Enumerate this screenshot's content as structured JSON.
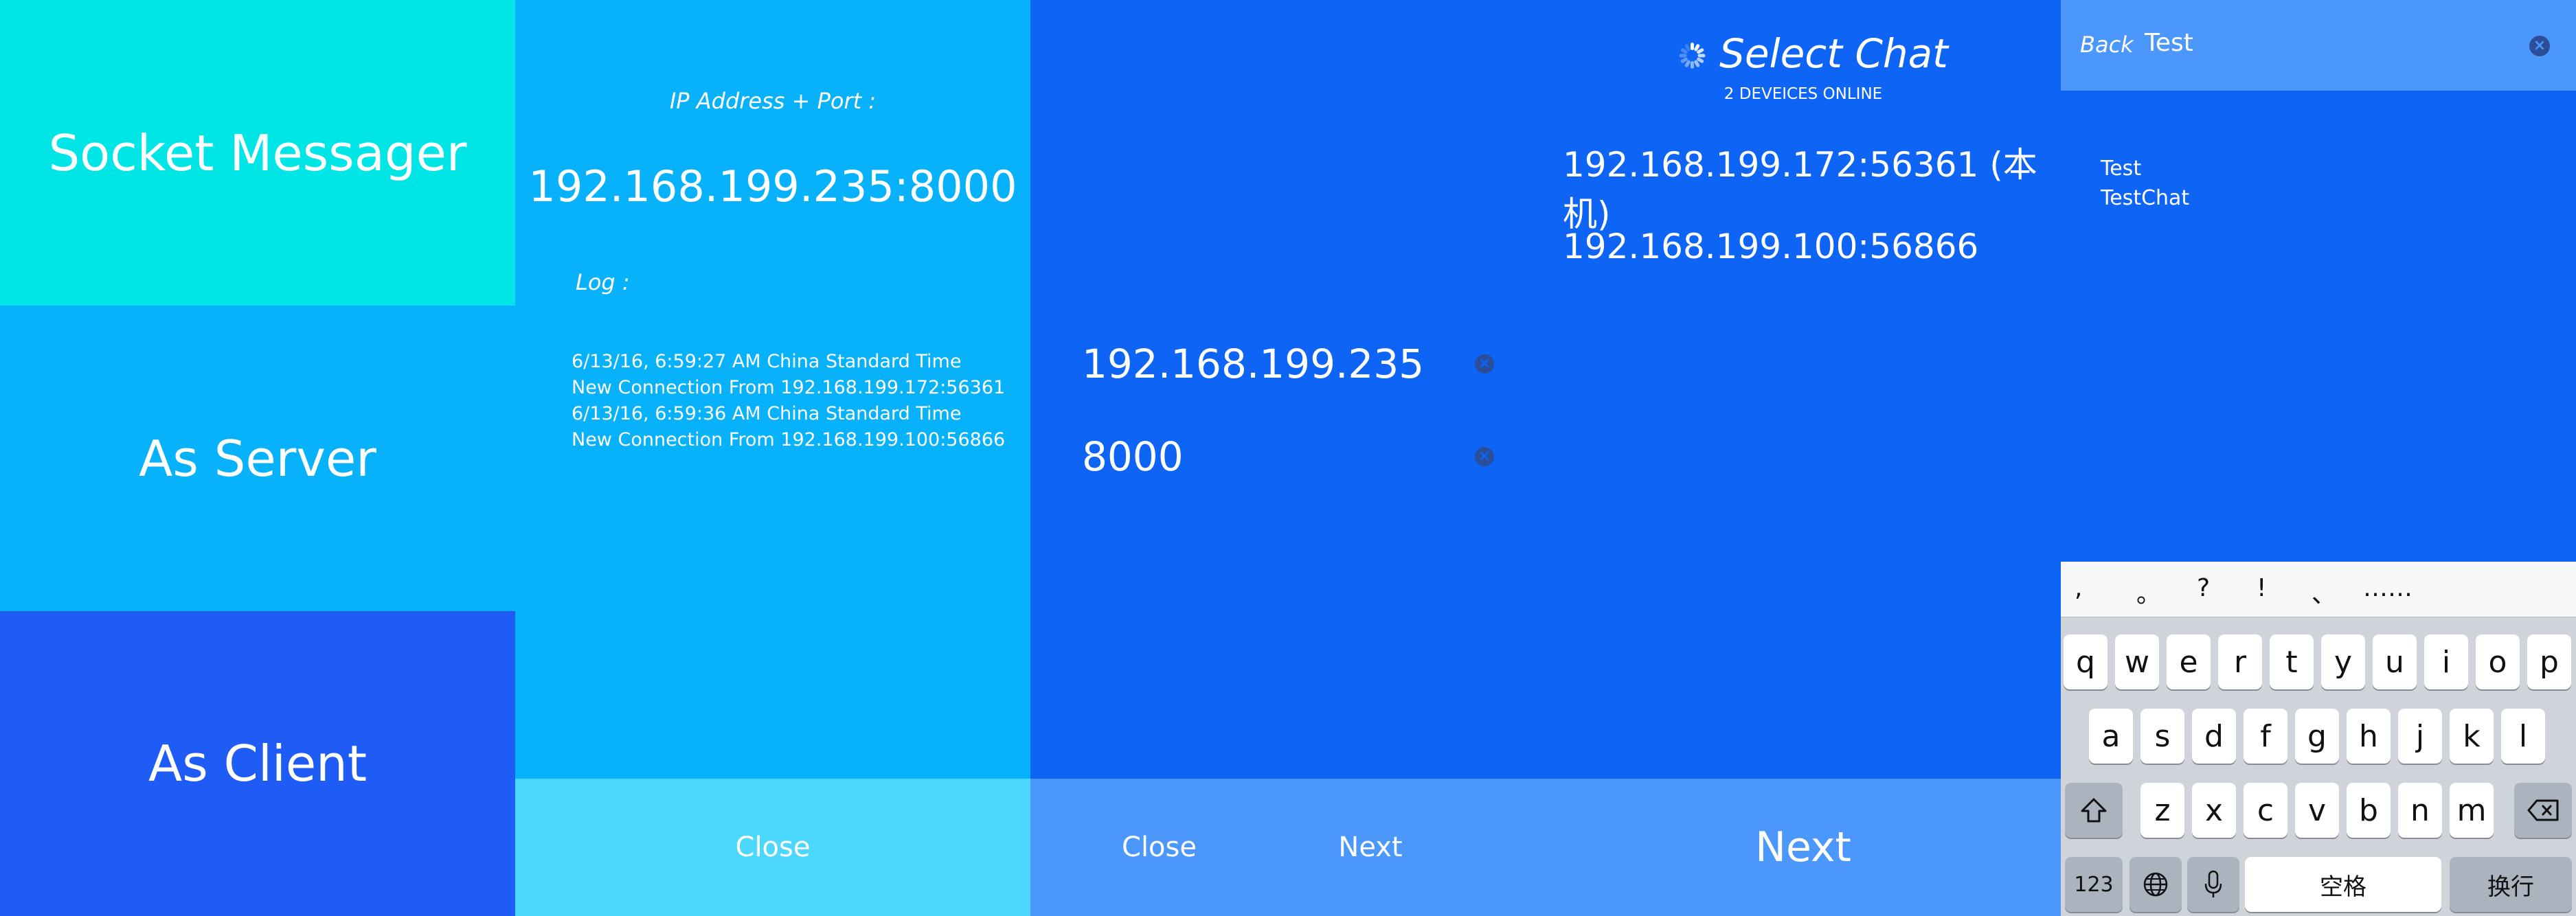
{
  "menu": {
    "socket_messager": "Socket Messager",
    "as_server": "As Server",
    "as_client": "As Client"
  },
  "server": {
    "ip_label": "IP Address + Port :",
    "ip_value": "192.168.199.235:8000",
    "log_label": "Log :",
    "log_lines": [
      "6/13/16, 6:59:27 AM China Standard Time",
      "New Connection From 192.168.199.172:56361",
      "6/13/16, 6:59:36 AM China Standard Time",
      "New Connection From 192.168.199.100:56866"
    ],
    "close_label": "Close"
  },
  "client": {
    "ip_field": "192.168.199.235",
    "port_field": "8000",
    "close_label": "Close",
    "next_label": "Next"
  },
  "select_chat": {
    "title": "Select Chat",
    "subtitle": "2 DEVEICES ONLINE",
    "devices": [
      "192.168.199.172:56361 (本机)",
      "192.168.199.100:56866"
    ],
    "next_label": "Next"
  },
  "chat": {
    "back_label": "Back",
    "input_value": "Test",
    "messages": [
      "Test",
      "TestChat"
    ],
    "suggestions": [
      ",",
      "。",
      "?",
      "!",
      "、",
      "……"
    ],
    "keyboard": {
      "row1": [
        "q",
        "w",
        "e",
        "r",
        "t",
        "y",
        "u",
        "i",
        "o",
        "p"
      ],
      "row2": [
        "a",
        "s",
        "d",
        "f",
        "g",
        "h",
        "j",
        "k",
        "l"
      ],
      "row3": [
        "z",
        "x",
        "c",
        "v",
        "b",
        "n",
        "m"
      ],
      "numbers_label": "123",
      "space_label": "空格",
      "return_label": "换行"
    }
  },
  "colors": {
    "menu_top": "#00e6e6",
    "menu_mid": "#08b2fb",
    "menu_bottom": "#1f5bf5",
    "blue_bg": "#0d64f5",
    "server_bar": "#4cd8fd",
    "client_bar": "#4b97fb"
  }
}
